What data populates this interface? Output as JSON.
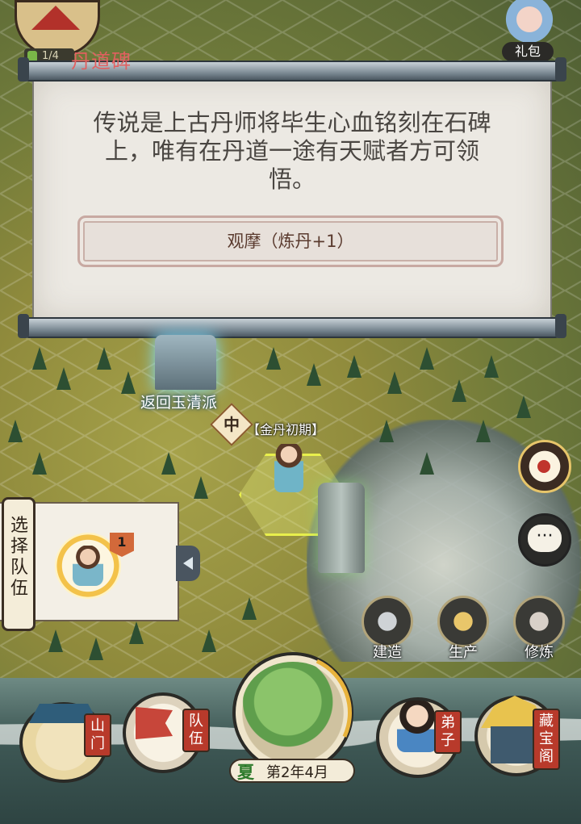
{
  "top": {
    "progress": "1/4",
    "gift_label": "礼包"
  },
  "dialog": {
    "title": "丹道碑",
    "description": "传说是上古丹师将毕生心血铭刻在石碑上，唯有在丹道一途有天赋者方可领悟。",
    "action_label": "观摩（炼丹+1）"
  },
  "map": {
    "portal_label": "返回玉清派",
    "rank_char": "中",
    "rank_text": "【金丹初期】"
  },
  "team_panel": {
    "label": "选择队伍",
    "flag_number": "1"
  },
  "actions": {
    "build": "建造",
    "produce": "生产",
    "cultivate": "修炼"
  },
  "bottom_nav": {
    "gate": "山门",
    "team": "队伍",
    "disciple": "弟子",
    "treasure": "藏宝阁",
    "season": "夏",
    "date": "第2年4月"
  },
  "colors": {
    "dialog_title": "#e26060",
    "paper": "#ece9e3",
    "button_border": "#c8a9a2",
    "nav_tag": "#b83a2b",
    "season_text": "#2d7a2b",
    "hex_select": "#e8ef4c"
  },
  "icons": {
    "refine": "pill-hand-icon",
    "chat": "chat-bubble-icon",
    "build": "hammer-icon",
    "produce": "wheat-icon",
    "cultivate": "meditator-icon",
    "collapse": "chevron-left-icon"
  }
}
